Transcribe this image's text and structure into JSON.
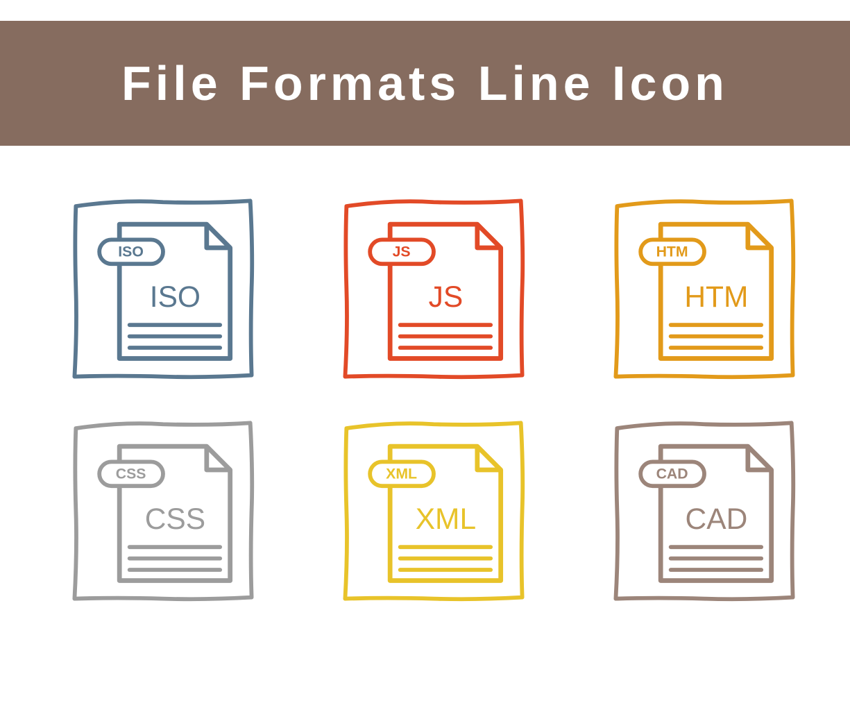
{
  "header": {
    "title": "File Formats Line Icon",
    "bg_color": "#866c5f"
  },
  "icons": [
    {
      "name": "iso-file-icon",
      "badge": "ISO",
      "label": "ISO",
      "color": "#5a7890"
    },
    {
      "name": "js-file-icon",
      "badge": "JS",
      "label": "JS",
      "color": "#e24a27"
    },
    {
      "name": "htm-file-icon",
      "badge": "HTM",
      "label": "HTM",
      "color": "#e29a1a"
    },
    {
      "name": "css-file-icon",
      "badge": "CSS",
      "label": "CSS",
      "color": "#9c9c9c"
    },
    {
      "name": "xml-file-icon",
      "badge": "XML",
      "label": "XML",
      "color": "#e8c32a"
    },
    {
      "name": "cad-file-icon",
      "badge": "CAD",
      "label": "CAD",
      "color": "#9c857a"
    }
  ]
}
